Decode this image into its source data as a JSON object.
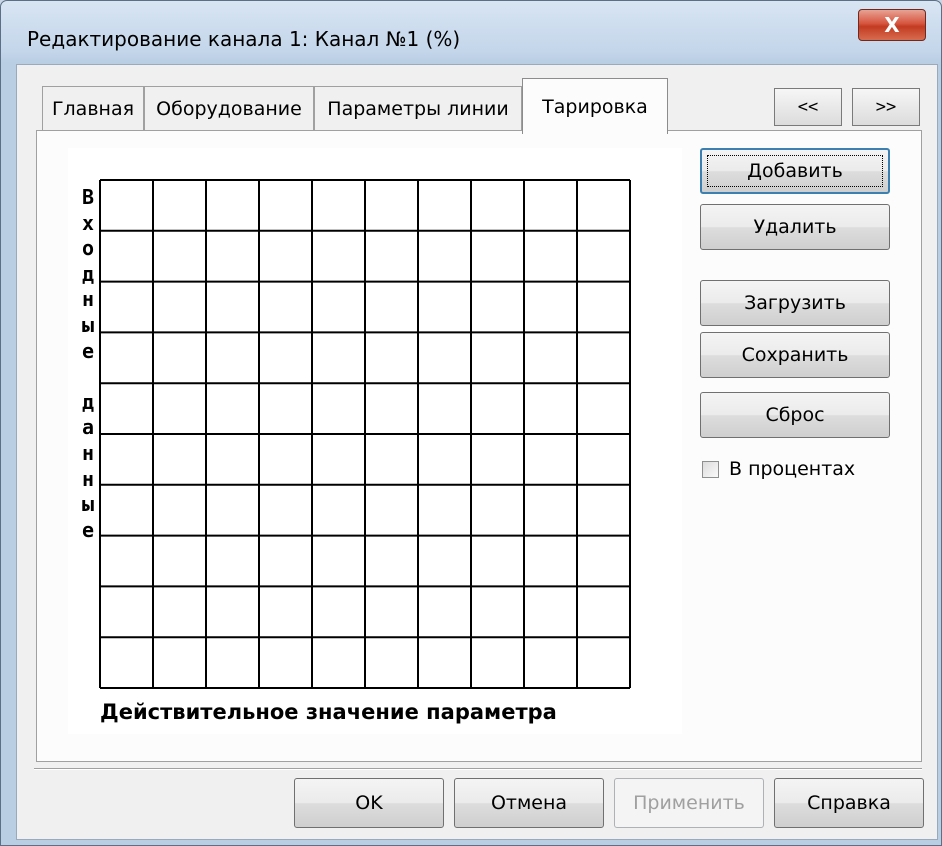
{
  "window": {
    "title": "Редактирование канала 1:  Канал №1 (%)",
    "close_label": "X"
  },
  "tabs": [
    {
      "label": "Главная",
      "active": false
    },
    {
      "label": "Оборудование",
      "active": false
    },
    {
      "label": "Параметры линии",
      "active": false
    },
    {
      "label": "Тарировка",
      "active": true
    }
  ],
  "nav": {
    "prev_label": "<<",
    "next_label": ">>"
  },
  "chart": {
    "y_label_chars": [
      "В",
      "х",
      "о",
      "д",
      "н",
      "ы",
      "е",
      "",
      "д",
      "а",
      "н",
      "н",
      "ы",
      "е"
    ],
    "x_label": "Действительное значение параметра",
    "grid": {
      "columns": 10,
      "rows": 10
    }
  },
  "side_buttons": {
    "add": "Добавить",
    "delete": "Удалить",
    "load": "Загрузить",
    "save": "Сохранить",
    "reset": "Сброс"
  },
  "percent_checkbox": {
    "label": "В процентах",
    "checked": false
  },
  "footer": {
    "ok": "OK",
    "cancel": "Отмена",
    "apply": "Применить",
    "help": "Справка"
  }
}
